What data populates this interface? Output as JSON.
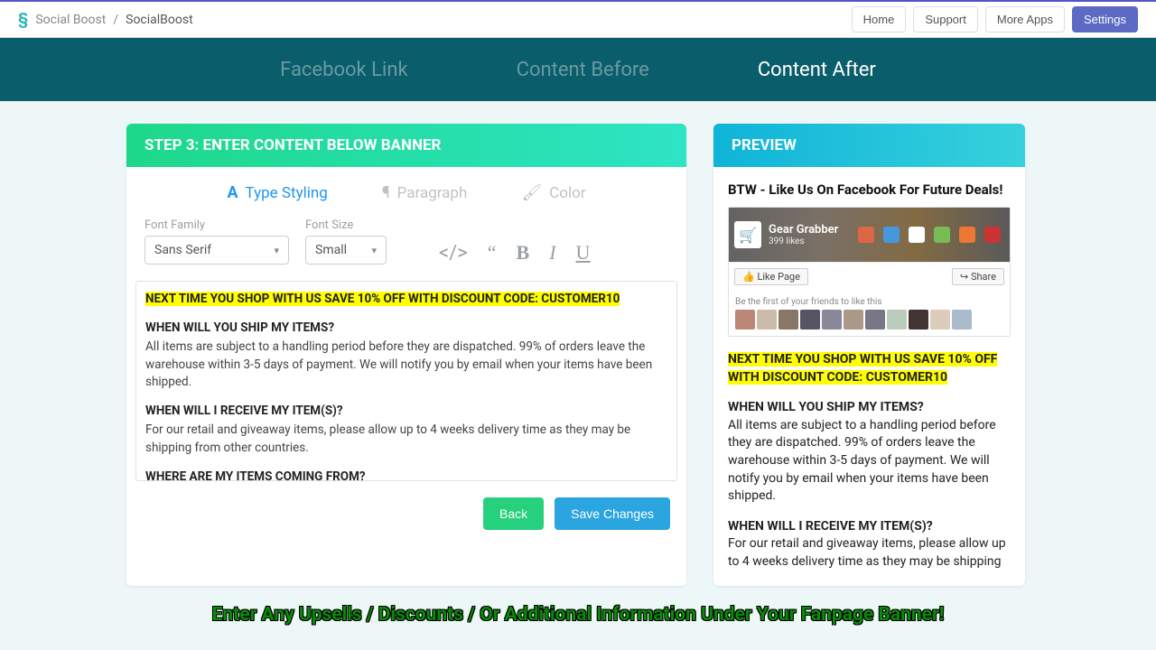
{
  "breadcrumb": {
    "app": "Social Boost",
    "page": "SocialBoost"
  },
  "top_buttons": {
    "home": "Home",
    "support": "Support",
    "more": "More Apps",
    "settings": "Settings"
  },
  "tabs": {
    "fb": "Facebook Link",
    "before": "Content Before",
    "after": "Content After"
  },
  "step_header": "STEP 3: ENTER CONTENT BELOW BANNER",
  "tool_tabs": {
    "type": "Type Styling",
    "para": "Paragraph",
    "color": "Color"
  },
  "fields": {
    "ff_label": "Font Family",
    "ff_value": "Sans Serif",
    "fs_label": "Font Size",
    "fs_value": "Small"
  },
  "editor": {
    "hl": "NEXT TIME YOU SHOP WITH US SAVE 10% OFF WITH DISCOUNT CODE: CUSTOMER10",
    "q1": "WHEN WILL YOU SHIP MY ITEMS?",
    "a1": "All items are subject to a handling period before they are dispatched. 99% of orders leave the warehouse within 3-5 days of payment. We will notify you by email when your items have been shipped.",
    "q2": "WHEN WILL I RECEIVE MY ITEM(S)?",
    "a2": "For our retail and giveaway items, please allow up to 4 weeks delivery time as they may be shipping from other countries.",
    "q3": "WHERE ARE MY ITEMS COMING FROM?"
  },
  "buttons": {
    "back": "Back",
    "save": "Save Changes"
  },
  "preview": {
    "header": "PREVIEW",
    "fb_title": "BTW - Like Us On Facebook For Future Deals!",
    "brand": "Gear Grabber",
    "likes": "399 likes",
    "like_btn": "Like Page",
    "share_btn": "Share",
    "friends": "Be the first of your friends to like this",
    "hl": "NEXT TIME YOU SHOP WITH US SAVE 10% OFF WITH DISCOUNT CODE: CUSTOMER10",
    "q1": "WHEN WILL YOU SHIP MY ITEMS?",
    "a1": "All items are subject to a handling period before they are dispatched. 99% of orders leave the warehouse within 3-5 days of payment. We will notify you by email when your items have been shipped.",
    "q2": "WHEN WILL I RECEIVE MY ITEM(S)?",
    "a2": "For our retail and giveaway items, please allow up to 4 weeks delivery time as they may be shipping"
  },
  "caption": "Enter Any Upsells / Discounts / Or Additional Information Under Your Fanpage Banner!"
}
